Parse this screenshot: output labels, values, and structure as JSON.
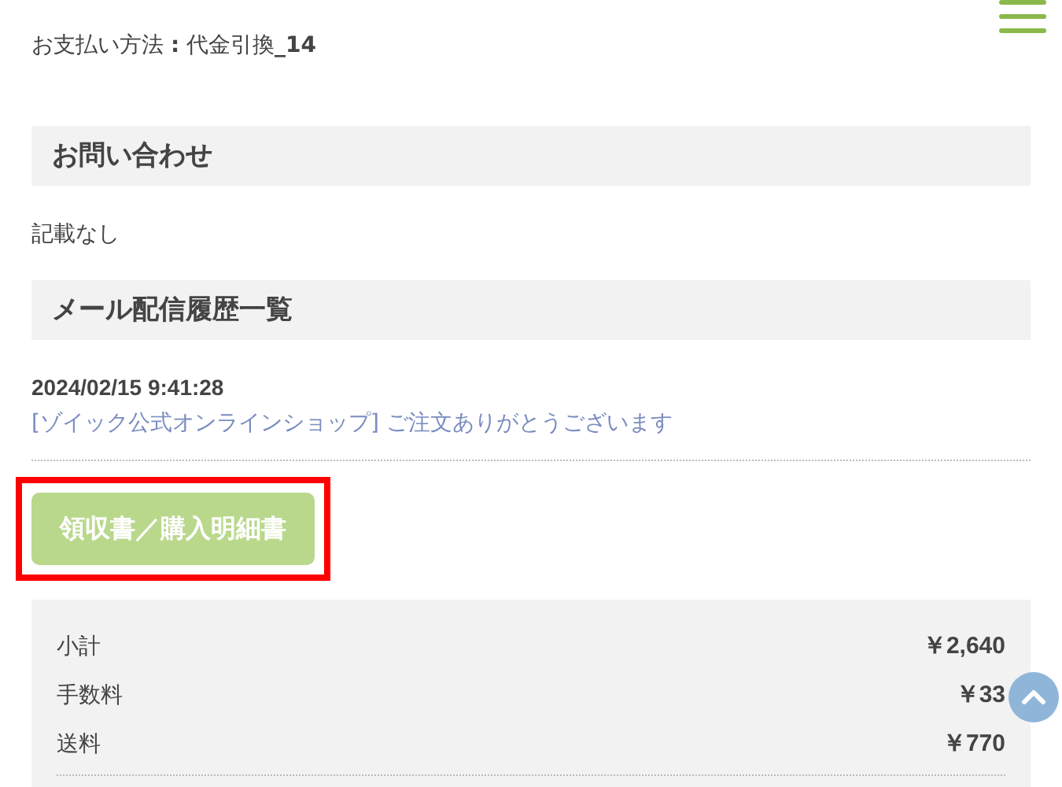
{
  "payment": "お支払い方法 **:** 代金引換**_14**",
  "contact": {
    "heading": "お問い合わせ",
    "text": "記載なし"
  },
  "mail_history": {
    "heading": "メール配信履歴一覧",
    "entries": [
      {
        "date": "2024/02/15 9:41:28",
        "subject": "[ゾイック公式オンラインショップ] ご注文ありがとうございます"
      }
    ]
  },
  "receipt_button": {
    "label": "領収書／購入明細書",
    "highlighted": true
  },
  "totals": [
    {
      "label": "小計",
      "value": "￥2,640"
    },
    {
      "label": "手数料",
      "value": "￥33"
    },
    {
      "label": "送料",
      "value": "￥770"
    }
  ]
}
